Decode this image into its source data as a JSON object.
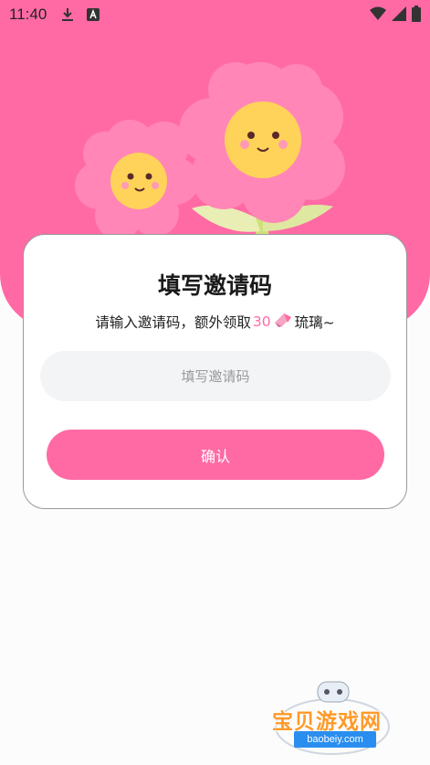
{
  "status_bar": {
    "time": "11:40",
    "icons": [
      "download-icon",
      "font-a-icon",
      "wifi-icon",
      "signal-icon",
      "battery-icon"
    ]
  },
  "dialog": {
    "title": "填写邀请码",
    "subtitle_prefix": "请输入邀请码，额外领取",
    "reward_amount": "30",
    "subtitle_suffix": "琉璃~",
    "input_placeholder": "填写邀请码",
    "input_value": "",
    "confirm_label": "确认"
  },
  "watermark": {
    "text": "宝贝游戏网",
    "url": "baobeiy.com"
  },
  "colors": {
    "accent": "#ff6aa5",
    "input_bg": "#f3f4f6",
    "page_bg": "#fcfcfd"
  }
}
